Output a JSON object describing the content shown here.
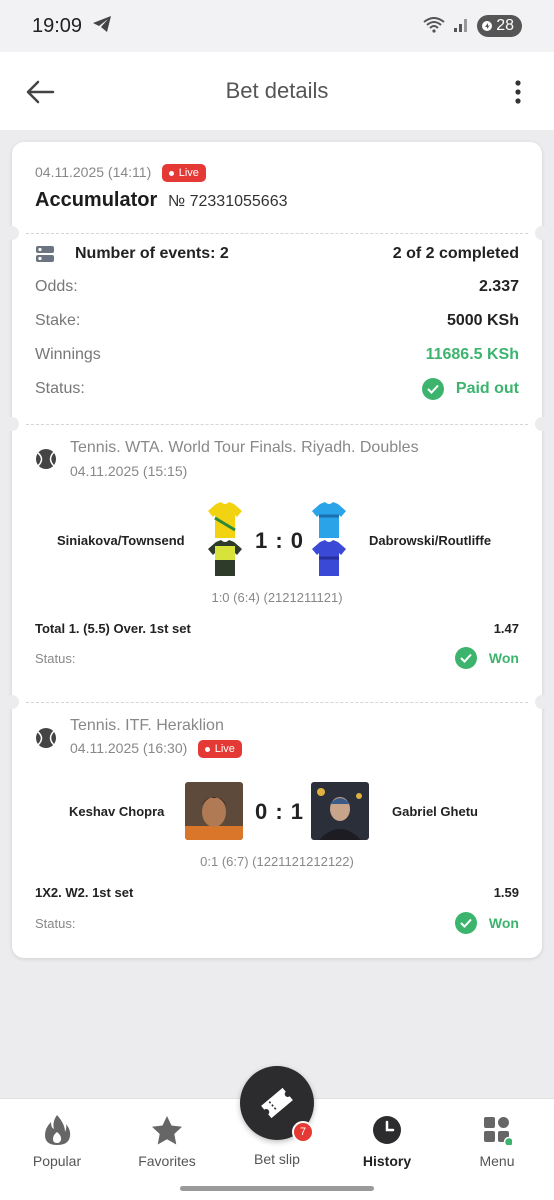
{
  "status_bar": {
    "time": "19:09",
    "battery": "28"
  },
  "header": {
    "title": "Bet details"
  },
  "bet": {
    "date": "04.11.2025 (14:11)",
    "live_label": "Live",
    "type": "Accumulator",
    "number": "№ 72331055663",
    "events_label": "Number of events: 2",
    "events_completed": "2 of 2 completed",
    "odds_label": "Odds:",
    "odds_value": "2.337",
    "stake_label": "Stake:",
    "stake_value": "5000 KSh",
    "winnings_label": "Winnings",
    "winnings_value": "11686.5 KSh",
    "status_label": "Status:",
    "status_value": "Paid out"
  },
  "events": [
    {
      "tournament": "Tennis. WTA. World Tour Finals. Riyadh. Doubles",
      "date": "04.11.2025 (15:15)",
      "team1": "Siniakova/Townsend",
      "team2": "Dabrowski/Routliffe",
      "score": "1 : 0",
      "score_detail": "1:0 (6:4) (2121211121)",
      "bet": "Total 1. (5.5) Over. 1st set",
      "odds": "1.47",
      "status_label": "Status:",
      "result": "Won"
    },
    {
      "tournament": "Tennis. ITF. Heraklion",
      "date": "04.11.2025 (16:30)",
      "live_label": "Live",
      "team1": "Keshav Chopra",
      "team2": "Gabriel Ghetu",
      "score": "0 : 1",
      "score_detail": "0:1 (6:7) (1221121212122)",
      "bet": "1X2. W2. 1st set",
      "odds": "1.59",
      "status_label": "Status:",
      "result": "Won"
    }
  ],
  "nav": {
    "popular": "Popular",
    "favorites": "Favorites",
    "betslip": "Bet slip",
    "betslip_badge": "7",
    "history": "History",
    "menu": "Menu"
  },
  "colors": {
    "accent_green": "#3cb46e",
    "live_red": "#e53935",
    "betslip_dark": "#2c2c2e"
  }
}
